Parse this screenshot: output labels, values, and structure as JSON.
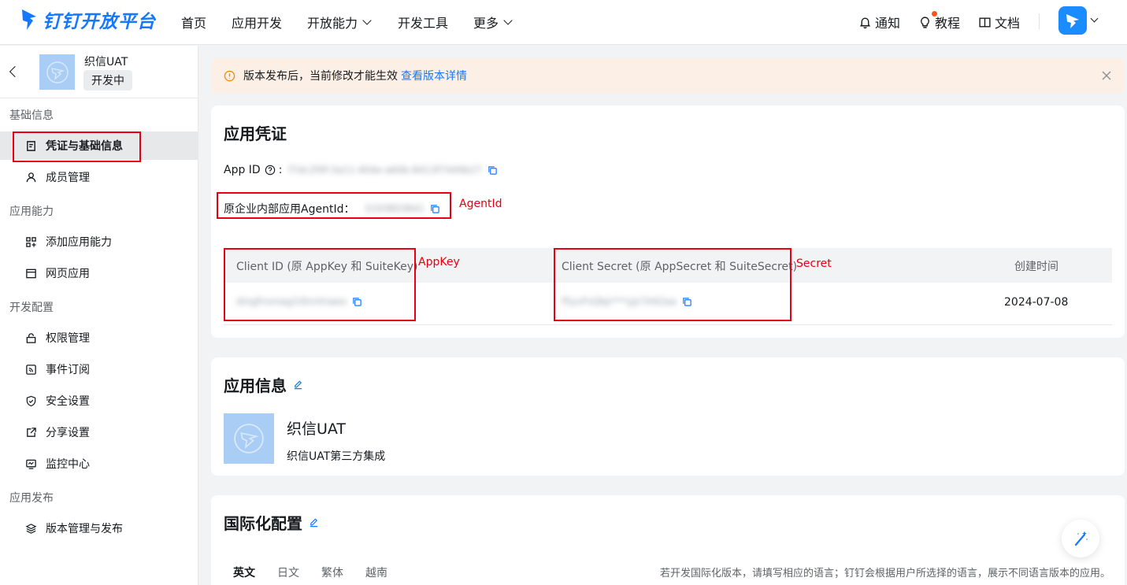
{
  "header": {
    "brand": "钉钉开放平台",
    "nav": [
      "首页",
      "应用开发",
      "开放能力",
      "开发工具",
      "更多"
    ],
    "notify": "通知",
    "tutorial": "教程",
    "docs": "文档"
  },
  "sidebar": {
    "app_name": "织信UAT",
    "status": "开发中",
    "groups": {
      "basic": "基础信息",
      "ability": "应用能力",
      "dev": "开发配置",
      "publish": "应用发布"
    },
    "items": {
      "credentials": "凭证与基础信息",
      "members": "成员管理",
      "add_ability": "添加应用能力",
      "web_app": "网页应用",
      "permissions": "权限管理",
      "events": "事件订阅",
      "security": "安全设置",
      "share": "分享设置",
      "monitor": "监控中心",
      "versions": "版本管理与发布"
    }
  },
  "alert": {
    "text": "版本发布后，当前修改才能生效",
    "link": "查看版本详情"
  },
  "credentials": {
    "title": "应用凭证",
    "app_id_label": "App ID",
    "app_id_value": "f7dc2f0f-3a11-404e-a60b-8413f7449b27",
    "agent_label": "原企业内部应用AgentId：",
    "agent_value": "3193803841",
    "agent_note": "AgentId",
    "col_client_id": "Client ID (原 AppKey 和 SuiteKey)",
    "col_secret": "Client Secret (原 AppSecret 和 SuiteSecret)",
    "col_created": "创建时间",
    "appkey_note": "AppKey",
    "secret_note": "Secret",
    "client_id_value": "dingfnxmag1l0nntnaeo",
    "secret_value": "f5yvFsQbJr***yJz7A92aa",
    "created_value": "2024-07-08"
  },
  "app_info": {
    "title": "应用信息",
    "name": "织信UAT",
    "desc": "织信UAT第三方集成"
  },
  "i18n": {
    "title": "国际化配置",
    "tabs": [
      "英文",
      "日文",
      "繁体",
      "越南"
    ],
    "hint": "若开发国际化版本，请填写相应的语言；钉钉会根据用户所选择的语言，展示不同语言版本的应用。"
  },
  "colors": {
    "accent": "#1677ff",
    "annotation": "#e60012"
  }
}
